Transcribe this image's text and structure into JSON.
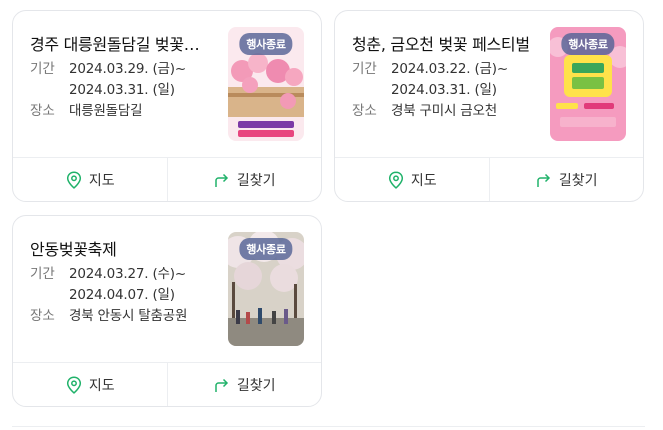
{
  "labels": {
    "period": "기간",
    "place": "장소"
  },
  "actions": {
    "map": "지도",
    "directions": "길찾기"
  },
  "accent_color": "#20b26a",
  "events": [
    {
      "title": "경주 대릉원돌담길 벚꽃축제",
      "date_start": "2024.03.29. (금)~",
      "date_end": "2024.03.31. (일)",
      "place": "대릉원돌담길",
      "badge": "행사종료"
    },
    {
      "title": "청춘, 금오천 벚꽃 페스티벌",
      "date_start": "2024.03.22. (금)~",
      "date_end": "2024.03.31. (일)",
      "place": "경북 구미시 금오천",
      "badge": "행사종료"
    },
    {
      "title": "안동벚꽃축제",
      "date_start": "2024.03.27. (수)~",
      "date_end": "2024.04.07. (일)",
      "place": "경북 안동시 탈춤공원",
      "badge": "행사종료"
    }
  ]
}
